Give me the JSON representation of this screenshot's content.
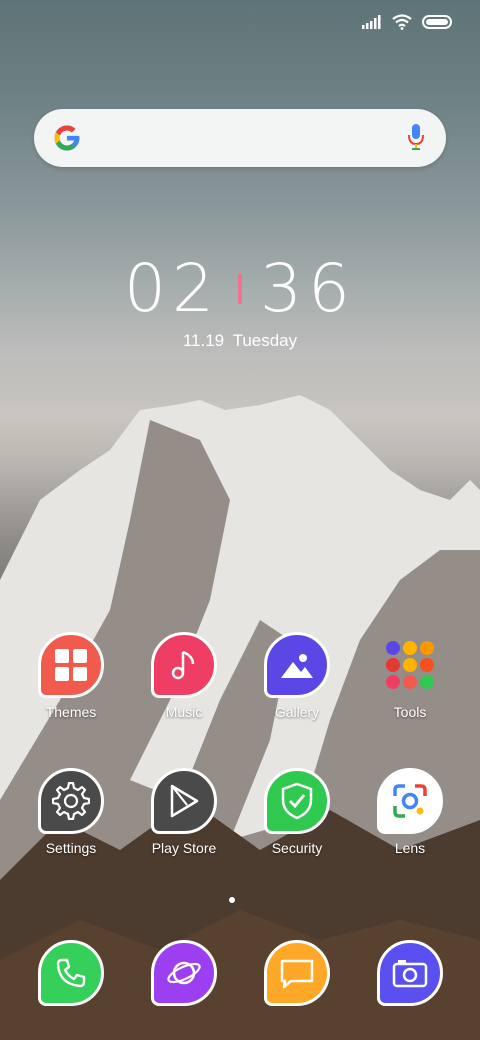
{
  "status": {
    "icons": [
      "signal-icon",
      "wifi-icon",
      "battery-icon"
    ]
  },
  "search": {
    "icons": [
      "google-logo-icon",
      "microphone-icon"
    ]
  },
  "clock": {
    "hours": "02",
    "minutes": "36",
    "date": "11.19",
    "day": "Tuesday"
  },
  "apps": [
    {
      "label": "Themes",
      "color": "#f25a4e"
    },
    {
      "label": "Music",
      "color": "#ef3e63"
    },
    {
      "label": "Gallery",
      "color": "#5b47e6"
    },
    {
      "label": "Tools",
      "color": "transparent"
    },
    {
      "label": "Settings",
      "color": "#4a4a4a"
    },
    {
      "label": "Play Store",
      "color": "#4a4a4a"
    },
    {
      "label": "Security",
      "color": "#2fc94f"
    },
    {
      "label": "Lens",
      "color": "#ffffff"
    }
  ],
  "dock": [
    {
      "name": "phone",
      "color": "#35d05a"
    },
    {
      "name": "browser",
      "color": "#9c3ff0"
    },
    {
      "name": "messages",
      "color": "#ffa726"
    },
    {
      "name": "camera",
      "color": "#5a4ff0"
    }
  ],
  "page_indicator": {
    "current": 1,
    "total": 1
  }
}
